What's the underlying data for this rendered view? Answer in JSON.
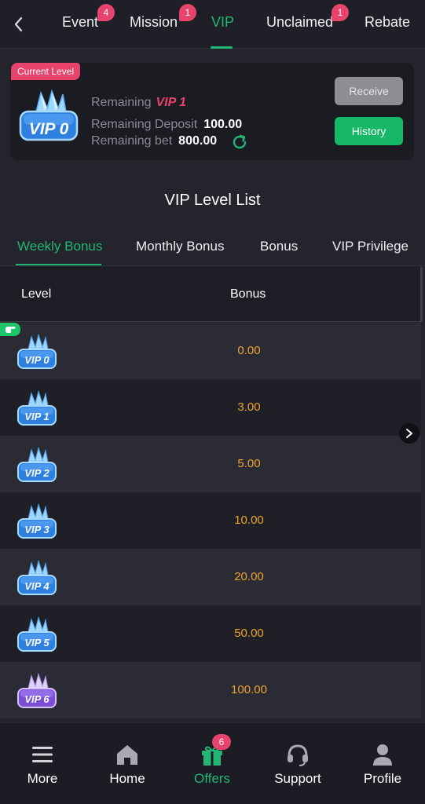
{
  "topnav": {
    "tabs": [
      {
        "label": "Event",
        "badge": "4"
      },
      {
        "label": "Mission",
        "badge": "1"
      },
      {
        "label": "VIP",
        "badge": ""
      },
      {
        "label": "Unclaimed",
        "badge": "1"
      },
      {
        "label": "Rebate",
        "badge": ""
      }
    ],
    "active_tab": "VIP"
  },
  "level_card": {
    "tag": "Current Level",
    "current_badge": "VIP 0",
    "remaining_label": "Remaining",
    "remaining_vip": "VIP 1",
    "deposit_label": "Remaining Deposit",
    "deposit_value": "100.00",
    "bet_label": "Remaining bet",
    "bet_value": "800.00",
    "receive_label": "Receive",
    "history_label": "History"
  },
  "list": {
    "title": "VIP Level List",
    "tabs": [
      "Weekly Bonus",
      "Monthly Bonus",
      "Bonus",
      "VIP Privilege"
    ],
    "active_tab": "Weekly Bonus",
    "columns": {
      "level": "Level",
      "bonus": "Bonus"
    },
    "rows": [
      {
        "level": "VIP 0",
        "bonus": "0.00",
        "current": true
      },
      {
        "level": "VIP 1",
        "bonus": "3.00"
      },
      {
        "level": "VIP 2",
        "bonus": "5.00"
      },
      {
        "level": "VIP 3",
        "bonus": "10.00"
      },
      {
        "level": "VIP 4",
        "bonus": "20.00"
      },
      {
        "level": "VIP 5",
        "bonus": "50.00"
      },
      {
        "level": "VIP 6",
        "bonus": "100.00"
      }
    ]
  },
  "bottomnav": {
    "items": [
      {
        "label": "More",
        "icon": "menu-icon"
      },
      {
        "label": "Home",
        "icon": "home-icon"
      },
      {
        "label": "Offers",
        "icon": "gift-icon",
        "badge": "6"
      },
      {
        "label": "Support",
        "icon": "headset-icon"
      },
      {
        "label": "Profile",
        "icon": "person-icon"
      }
    ],
    "active": "Offers"
  },
  "colors": {
    "accent": "#22b573",
    "badge": "#e8436d",
    "bonus": "#f0a22c",
    "background": "#23242c"
  }
}
